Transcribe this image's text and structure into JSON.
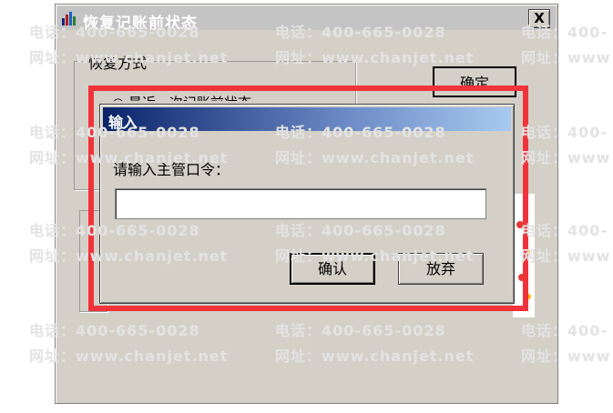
{
  "window": {
    "title": "恢复记账前状态",
    "close_label": "X",
    "group_restore_label": "恢复方式",
    "ok_button_label": "确定",
    "partial_option_text": "○ 最近一次记账前状态"
  },
  "input_dialog": {
    "title": "输入",
    "prompt": "请输入主管口令：",
    "password_value": "",
    "confirm_label": "确认",
    "cancel_label": "放弃"
  },
  "watermark": {
    "phone": "电话：400-665-0028",
    "website": "网址：www.chanjet.net",
    "phone_tail": "电话：400-",
    "website_tail": "网址：www"
  },
  "colors": {
    "highlight": "#f0333a",
    "dialog_title_start": "#0a246a",
    "dialog_title_end": "#a6caf0",
    "window_bg": "#d4d0c8"
  }
}
